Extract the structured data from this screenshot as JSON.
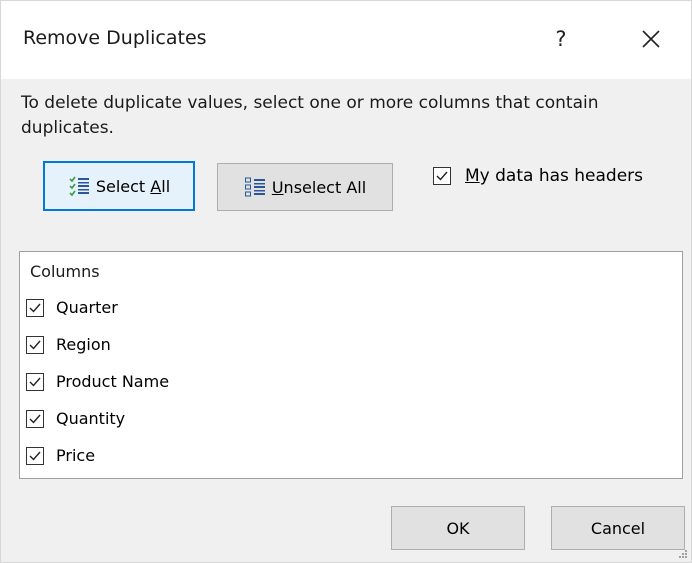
{
  "dialog": {
    "title": "Remove Duplicates",
    "help_label": "?",
    "instructions": "To delete duplicate values, select one or more columns that contain duplicates."
  },
  "buttons": {
    "select_all": {
      "prefix": "Select ",
      "accel": "A",
      "suffix": "ll",
      "icon": "select-all-icon"
    },
    "unselect_all": {
      "prefix": "",
      "accel": "U",
      "suffix": "nselect All",
      "icon": "unselect-all-icon"
    },
    "ok": "OK",
    "cancel": "Cancel"
  },
  "headers_option": {
    "prefix": "",
    "accel": "M",
    "suffix": "y data has headers",
    "checked": true
  },
  "columns": {
    "header": "Columns",
    "items": [
      {
        "label": "Quarter",
        "checked": true
      },
      {
        "label": "Region",
        "checked": true
      },
      {
        "label": "Product Name",
        "checked": true
      },
      {
        "label": "Quantity",
        "checked": true
      },
      {
        "label": "Price",
        "checked": true
      }
    ]
  },
  "colors": {
    "focus_border": "#0078d7",
    "dialog_bg": "#f0f0f0",
    "icon_green": "#3a9a47",
    "icon_blue": "#2b579a"
  }
}
